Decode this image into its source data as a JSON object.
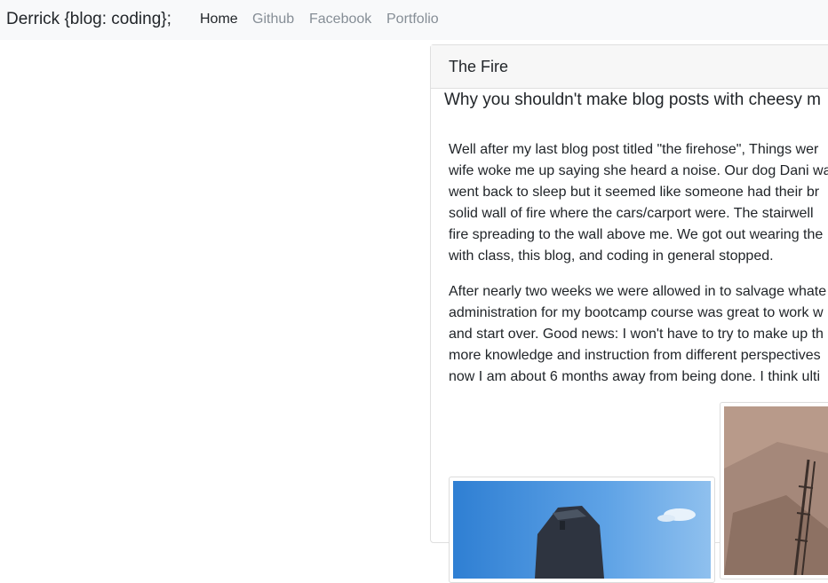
{
  "navbar": {
    "brand": "Derrick {blog: coding};",
    "links": [
      {
        "label": "Home",
        "active": true
      },
      {
        "label": "Github",
        "active": false
      },
      {
        "label": "Facebook",
        "active": false
      },
      {
        "label": "Portfolio",
        "active": false
      }
    ]
  },
  "post": {
    "title": "The Fire",
    "subtitle": "Why you shouldn't make blog posts with cheesy m",
    "paragraph1": [
      "Well after my last blog post titled \"the firehose\", Things wer",
      "wife woke me up saying she heard a noise. Our dog Dani wa",
      "went back to sleep but it seemed like someone had their br",
      "solid wall of fire where the cars/carport were. The stairwell",
      "fire spreading to the wall above me. We got out wearing the",
      "with class, this blog, and coding in general stopped."
    ],
    "paragraph2": [
      "After nearly two weeks we were allowed in to salvage whate",
      "administration for my bootcamp course was great to work w",
      "and start over. Good news: I won't have to try to make up th",
      "more knowledge and instruction from different perspectives",
      "now I am about 6 months away from being done. I think ulti"
    ]
  },
  "colors": {
    "navbar_bg": "#f8f9fa",
    "link_muted": "#868e96",
    "sky": "#3d8ad8",
    "rubble": "#a08270"
  }
}
